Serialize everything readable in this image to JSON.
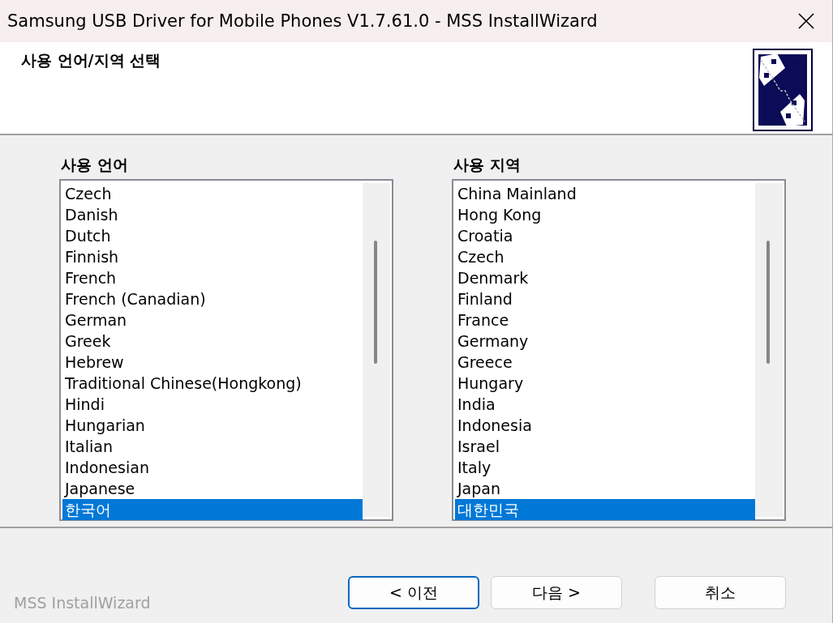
{
  "window": {
    "title": "Samsung USB Driver for Mobile Phones V1.7.61.0 - MSS InstallWizard"
  },
  "header": {
    "title": "사용 언어/지역 선택"
  },
  "lists": [
    {
      "label": "사용 언어",
      "items": [
        {
          "text": "Czech",
          "selected": false
        },
        {
          "text": "Danish",
          "selected": false
        },
        {
          "text": "Dutch",
          "selected": false
        },
        {
          "text": "Finnish",
          "selected": false
        },
        {
          "text": "French",
          "selected": false
        },
        {
          "text": "French (Canadian)",
          "selected": false
        },
        {
          "text": "German",
          "selected": false
        },
        {
          "text": "Greek",
          "selected": false
        },
        {
          "text": "Hebrew",
          "selected": false
        },
        {
          "text": "Traditional Chinese(Hongkong)",
          "selected": false
        },
        {
          "text": "Hindi",
          "selected": false
        },
        {
          "text": "Hungarian",
          "selected": false
        },
        {
          "text": "Italian",
          "selected": false
        },
        {
          "text": "Indonesian",
          "selected": false
        },
        {
          "text": "Japanese",
          "selected": false
        },
        {
          "text": "한국어",
          "selected": true
        }
      ]
    },
    {
      "label": "사용 지역",
      "items": [
        {
          "text": "China Mainland",
          "selected": false
        },
        {
          "text": "Hong Kong",
          "selected": false
        },
        {
          "text": "Croatia",
          "selected": false
        },
        {
          "text": "Czech",
          "selected": false
        },
        {
          "text": "Denmark",
          "selected": false
        },
        {
          "text": "Finland",
          "selected": false
        },
        {
          "text": "France",
          "selected": false
        },
        {
          "text": "Germany",
          "selected": false
        },
        {
          "text": "Greece",
          "selected": false
        },
        {
          "text": "Hungary",
          "selected": false
        },
        {
          "text": "India",
          "selected": false
        },
        {
          "text": "Indonesia",
          "selected": false
        },
        {
          "text": "Israel",
          "selected": false
        },
        {
          "text": "Italy",
          "selected": false
        },
        {
          "text": "Japan",
          "selected": false
        },
        {
          "text": "대한민국",
          "selected": true
        }
      ]
    }
  ],
  "footer": {
    "brand": "MSS InstallWizard"
  },
  "buttons": [
    {
      "label": "< 이전",
      "focused": true
    },
    {
      "label": "다음 >",
      "focused": false
    },
    {
      "label": "취소",
      "focused": false
    }
  ]
}
